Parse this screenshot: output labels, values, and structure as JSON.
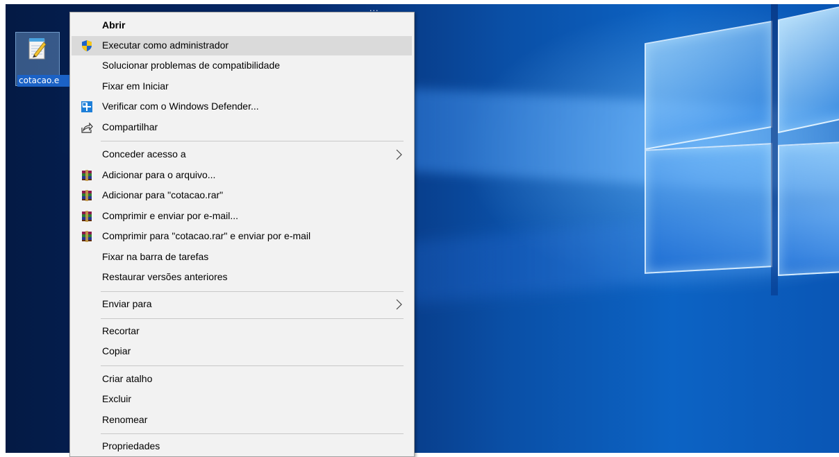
{
  "desktop": {
    "top_caption": "...",
    "icon": {
      "label": "cotacao.e",
      "name": "notepad-file-icon"
    }
  },
  "context_menu": {
    "items": [
      {
        "label": "Abrir",
        "bold": true
      },
      {
        "label": "Executar como administrador",
        "icon": "uac-shield-icon",
        "highlighted": true
      },
      {
        "label": "Solucionar problemas de compatibilidade"
      },
      {
        "label": "Fixar em Iniciar"
      },
      {
        "label": "Verificar com o Windows Defender...",
        "icon": "windows-defender-icon"
      },
      {
        "label": "Compartilhar",
        "icon": "share-icon"
      },
      {
        "label": "Conceder acesso a",
        "submenu": true
      },
      {
        "label": "Adicionar para o arquivo...",
        "icon": "winrar-icon"
      },
      {
        "label": "Adicionar para \"cotacao.rar\"",
        "icon": "winrar-icon"
      },
      {
        "label": "Comprimir e enviar por e-mail...",
        "icon": "winrar-icon"
      },
      {
        "label": "Comprimir para \"cotacao.rar\" e enviar por e-mail",
        "icon": "winrar-icon"
      },
      {
        "label": "Fixar na barra de tarefas"
      },
      {
        "label": "Restaurar versões anteriores"
      },
      {
        "label": "Enviar para",
        "submenu": true
      },
      {
        "label": "Recortar"
      },
      {
        "label": "Copiar"
      },
      {
        "label": "Criar atalho"
      },
      {
        "label": "Excluir"
      },
      {
        "label": "Renomear"
      },
      {
        "label": "Propriedades"
      }
    ],
    "colors": {
      "background": "#f2f2f2",
      "highlight": "#dadada",
      "separator": "#c8c8c8"
    }
  }
}
